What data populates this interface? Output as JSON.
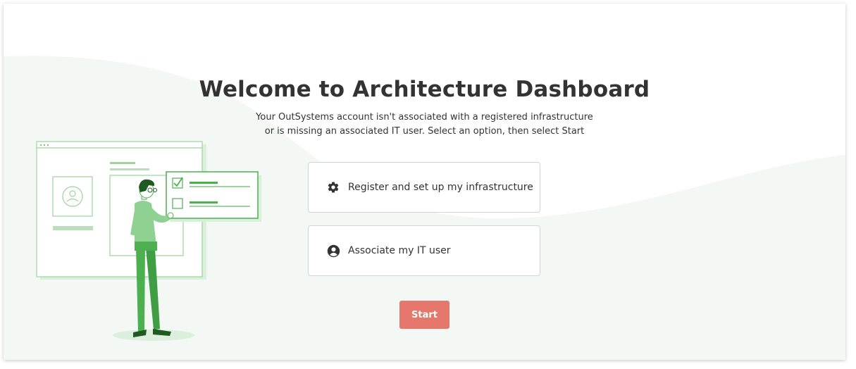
{
  "page": {
    "title": "Welcome to Architecture Dashboard",
    "subtitle_line1": "Your OutSystems account isn't associated with a registered infrastructure",
    "subtitle_line2": "or is missing an associated IT user. Select an option, then select Start"
  },
  "options": [
    {
      "label": "Register and set up my infrastructure",
      "icon": "gear-icon"
    },
    {
      "label": "Associate my IT user",
      "icon": "user-circle-icon"
    }
  ],
  "start_button": {
    "label": "Start",
    "color": "#e5776d"
  },
  "colors": {
    "accent_green": "#4caf50",
    "light_green": "#d8efd9",
    "background_wave": "#f3f8f4",
    "text": "#333333"
  }
}
